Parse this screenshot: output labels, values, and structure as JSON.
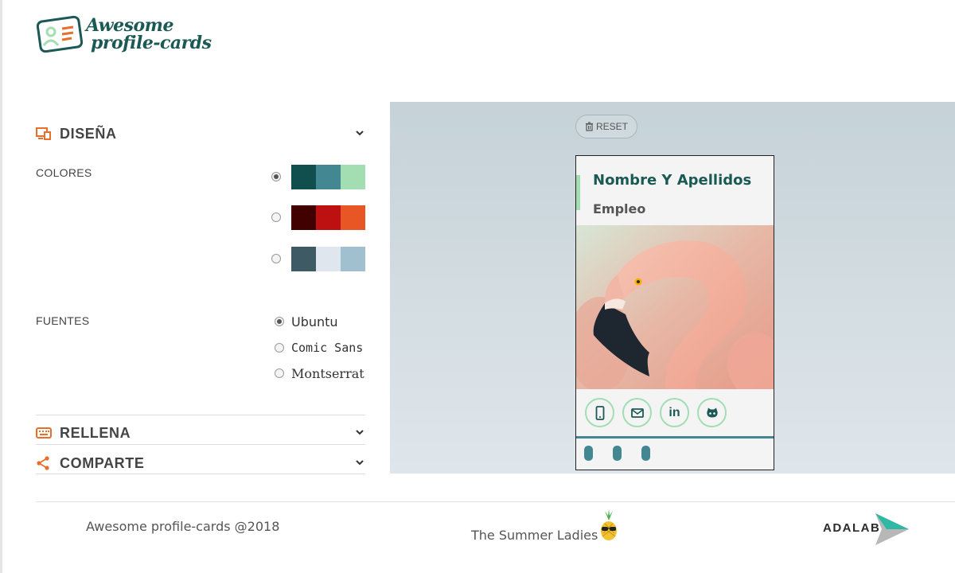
{
  "app": {
    "logo_line1": "Awesome",
    "logo_line2": "profile-cards"
  },
  "sections": {
    "design": {
      "title": "DISEÑA",
      "icon": "design-icon",
      "expanded": true
    },
    "fill": {
      "title": "RELLENA",
      "icon": "keyboard-icon",
      "expanded": false
    },
    "share": {
      "title": "COMPARTE",
      "icon": "share-icon",
      "expanded": false
    }
  },
  "colors": {
    "label": "COLORES",
    "palettes": [
      {
        "selected": true,
        "swatches": [
          "#114e4e",
          "#438792",
          "#a2deb2"
        ]
      },
      {
        "selected": false,
        "swatches": [
          "#420101",
          "#bd1010",
          "#e95626"
        ]
      },
      {
        "selected": false,
        "swatches": [
          "#3e5b65",
          "#dfe6ee",
          "#a0c0cf"
        ]
      }
    ]
  },
  "fonts": {
    "label": "FUENTES",
    "options": [
      {
        "label": "Ubuntu",
        "selected": true
      },
      {
        "label": "Comic Sans",
        "selected": false
      },
      {
        "label": "Montserrat",
        "selected": false
      }
    ]
  },
  "preview": {
    "reset_label": "RESET",
    "card": {
      "name": "Nombre Y Apellidos",
      "job": "Empleo",
      "icons": [
        "phone-icon",
        "envelope-icon",
        "linkedin-icon",
        "github-icon"
      ],
      "linkedin_text": "in"
    }
  },
  "footer": {
    "copyright": "Awesome profile-cards @2018",
    "team": "The Summer Ladies",
    "brand": "ADALAB"
  },
  "accent": {
    "card_name": "#1b5a54",
    "section_icons": "#e86f2a",
    "card_ring": "#a2deb2"
  }
}
